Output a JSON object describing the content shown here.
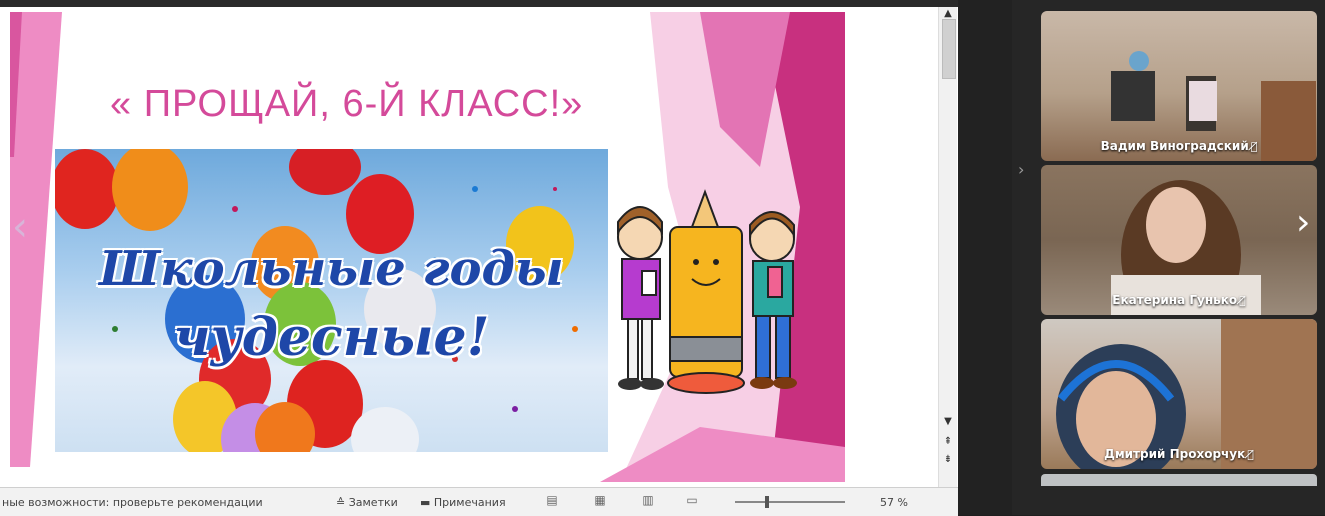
{
  "slide": {
    "title": "« ПРОЩАЙ, 6-Й  КЛАСС!»",
    "cursive_line1": "Школьные годы",
    "cursive_line2": "чудесные!",
    "colors": {
      "pink": "#d44a9a",
      "magenta": "#c8307f",
      "blue_text": "#1e47a8"
    }
  },
  "statusbar": {
    "accessibility": "ные возможности: проверьте рекомендации",
    "notes": "Заметки",
    "comments": "Примечания",
    "zoom": "57 %"
  },
  "participants": [
    {
      "name": "Вадим Виноградский",
      "muted": true
    },
    {
      "name": "Екатерина Гунько",
      "muted": true
    },
    {
      "name": "Дмитрий Прохорчук",
      "muted": true
    }
  ],
  "icons": {
    "mute": "mic-muted-icon",
    "next": "chevron-right-icon",
    "prev": "chevron-left-icon",
    "collapse": "collapse-panel-icon"
  }
}
